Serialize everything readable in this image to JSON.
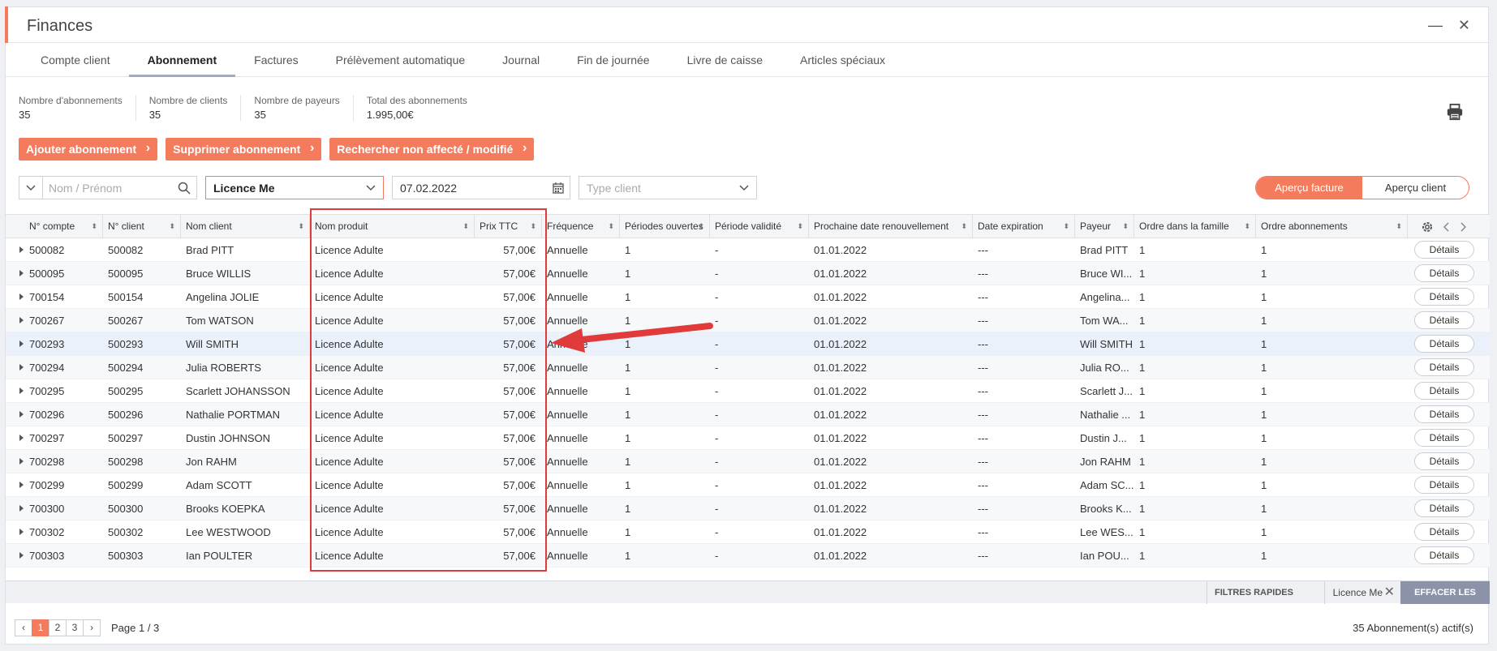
{
  "window": {
    "title": "Finances",
    "minimize": "—",
    "close": "✕"
  },
  "tabs": [
    "Compte client",
    "Abonnement",
    "Factures",
    "Prélèvement automatique",
    "Journal",
    "Fin de journée",
    "Livre de caisse",
    "Articles spéciaux"
  ],
  "active_tab": "Abonnement",
  "stats": [
    {
      "label": "Nombre d'abonnements",
      "value": "35"
    },
    {
      "label": "Nombre de clients",
      "value": "35"
    },
    {
      "label": "Nombre de payeurs",
      "value": "35"
    },
    {
      "label": "Total des abonnements",
      "value": "1.995,00€"
    }
  ],
  "actions": [
    "Ajouter abonnement",
    "Supprimer abonnement",
    "Rechercher non affecté / modifié"
  ],
  "filters": {
    "name_placeholder": "Nom / Prénom",
    "licence_value": "Licence Me",
    "date_value": "07.02.2022",
    "type_placeholder": "Type client"
  },
  "view_toggle": {
    "invoice": "Aperçu facture",
    "client": "Aperçu client",
    "active": "invoice"
  },
  "columns": [
    "N° compte",
    "N° client",
    "Nom client",
    "Nom produit",
    "Prix TTC",
    "Fréquence",
    "Périodes ouvertes",
    "Période validité",
    "Prochaine date renouvellement",
    "Date expiration",
    "Payeur",
    "Ordre dans la famille",
    "Ordre abonnements"
  ],
  "details_label": "Détails",
  "rows": [
    [
      "500082",
      "500082",
      "Brad PITT",
      "Licence Adulte",
      "57,00€",
      "Annuelle",
      "1",
      "-",
      "01.01.2022",
      "---",
      "Brad PITT",
      "1",
      "1"
    ],
    [
      "500095",
      "500095",
      "Bruce WILLIS",
      "Licence Adulte",
      "57,00€",
      "Annuelle",
      "1",
      "-",
      "01.01.2022",
      "---",
      "Bruce WI...",
      "1",
      "1"
    ],
    [
      "700154",
      "500154",
      "Angelina JOLIE",
      "Licence Adulte",
      "57,00€",
      "Annuelle",
      "1",
      "-",
      "01.01.2022",
      "---",
      "Angelina...",
      "1",
      "1"
    ],
    [
      "700267",
      "500267",
      "Tom WATSON",
      "Licence Adulte",
      "57,00€",
      "Annuelle",
      "1",
      "-",
      "01.01.2022",
      "---",
      "Tom WA...",
      "1",
      "1"
    ],
    [
      "700293",
      "500293",
      "Will SMITH",
      "Licence Adulte",
      "57,00€",
      "Annuelle",
      "1",
      "-",
      "01.01.2022",
      "---",
      "Will SMITH",
      "1",
      "1"
    ],
    [
      "700294",
      "500294",
      "Julia ROBERTS",
      "Licence Adulte",
      "57,00€",
      "Annuelle",
      "1",
      "-",
      "01.01.2022",
      "---",
      "Julia RO...",
      "1",
      "1"
    ],
    [
      "700295",
      "500295",
      "Scarlett JOHANSSON",
      "Licence Adulte",
      "57,00€",
      "Annuelle",
      "1",
      "-",
      "01.01.2022",
      "---",
      "Scarlett J...",
      "1",
      "1"
    ],
    [
      "700296",
      "500296",
      "Nathalie PORTMAN",
      "Licence Adulte",
      "57,00€",
      "Annuelle",
      "1",
      "-",
      "01.01.2022",
      "---",
      "Nathalie ...",
      "1",
      "1"
    ],
    [
      "700297",
      "500297",
      "Dustin JOHNSON",
      "Licence Adulte",
      "57,00€",
      "Annuelle",
      "1",
      "-",
      "01.01.2022",
      "---",
      "Dustin J...",
      "1",
      "1"
    ],
    [
      "700298",
      "500298",
      "Jon RAHM",
      "Licence Adulte",
      "57,00€",
      "Annuelle",
      "1",
      "-",
      "01.01.2022",
      "---",
      "Jon RAHM",
      "1",
      "1"
    ],
    [
      "700299",
      "500299",
      "Adam SCOTT",
      "Licence Adulte",
      "57,00€",
      "Annuelle",
      "1",
      "-",
      "01.01.2022",
      "---",
      "Adam SC...",
      "1",
      "1"
    ],
    [
      "700300",
      "500300",
      "Brooks KOEPKA",
      "Licence Adulte",
      "57,00€",
      "Annuelle",
      "1",
      "-",
      "01.01.2022",
      "---",
      "Brooks K...",
      "1",
      "1"
    ],
    [
      "700302",
      "500302",
      "Lee WESTWOOD",
      "Licence Adulte",
      "57,00€",
      "Annuelle",
      "1",
      "-",
      "01.01.2022",
      "---",
      "Lee WES...",
      "1",
      "1"
    ],
    [
      "700303",
      "500303",
      "Ian POULTER",
      "Licence Adulte",
      "57,00€",
      "Annuelle",
      "1",
      "-",
      "01.01.2022",
      "---",
      "Ian POU...",
      "1",
      "1"
    ]
  ],
  "highlighted_row": 4,
  "quick_filters": {
    "label": "FILTRES RAPIDES",
    "chip": "Licence Me",
    "clear": "EFFACER LES FILTRES"
  },
  "pagination": {
    "pages": [
      "1",
      "2",
      "3"
    ],
    "current": "1",
    "prev": "‹",
    "next": "›",
    "text": "Page 1 / 3"
  },
  "footer_total": "35 Abonnement(s) actif(s)",
  "colors": {
    "accent": "#f47c5c",
    "annotation": "#e03a3a",
    "clear_button": "#8c93a8"
  }
}
